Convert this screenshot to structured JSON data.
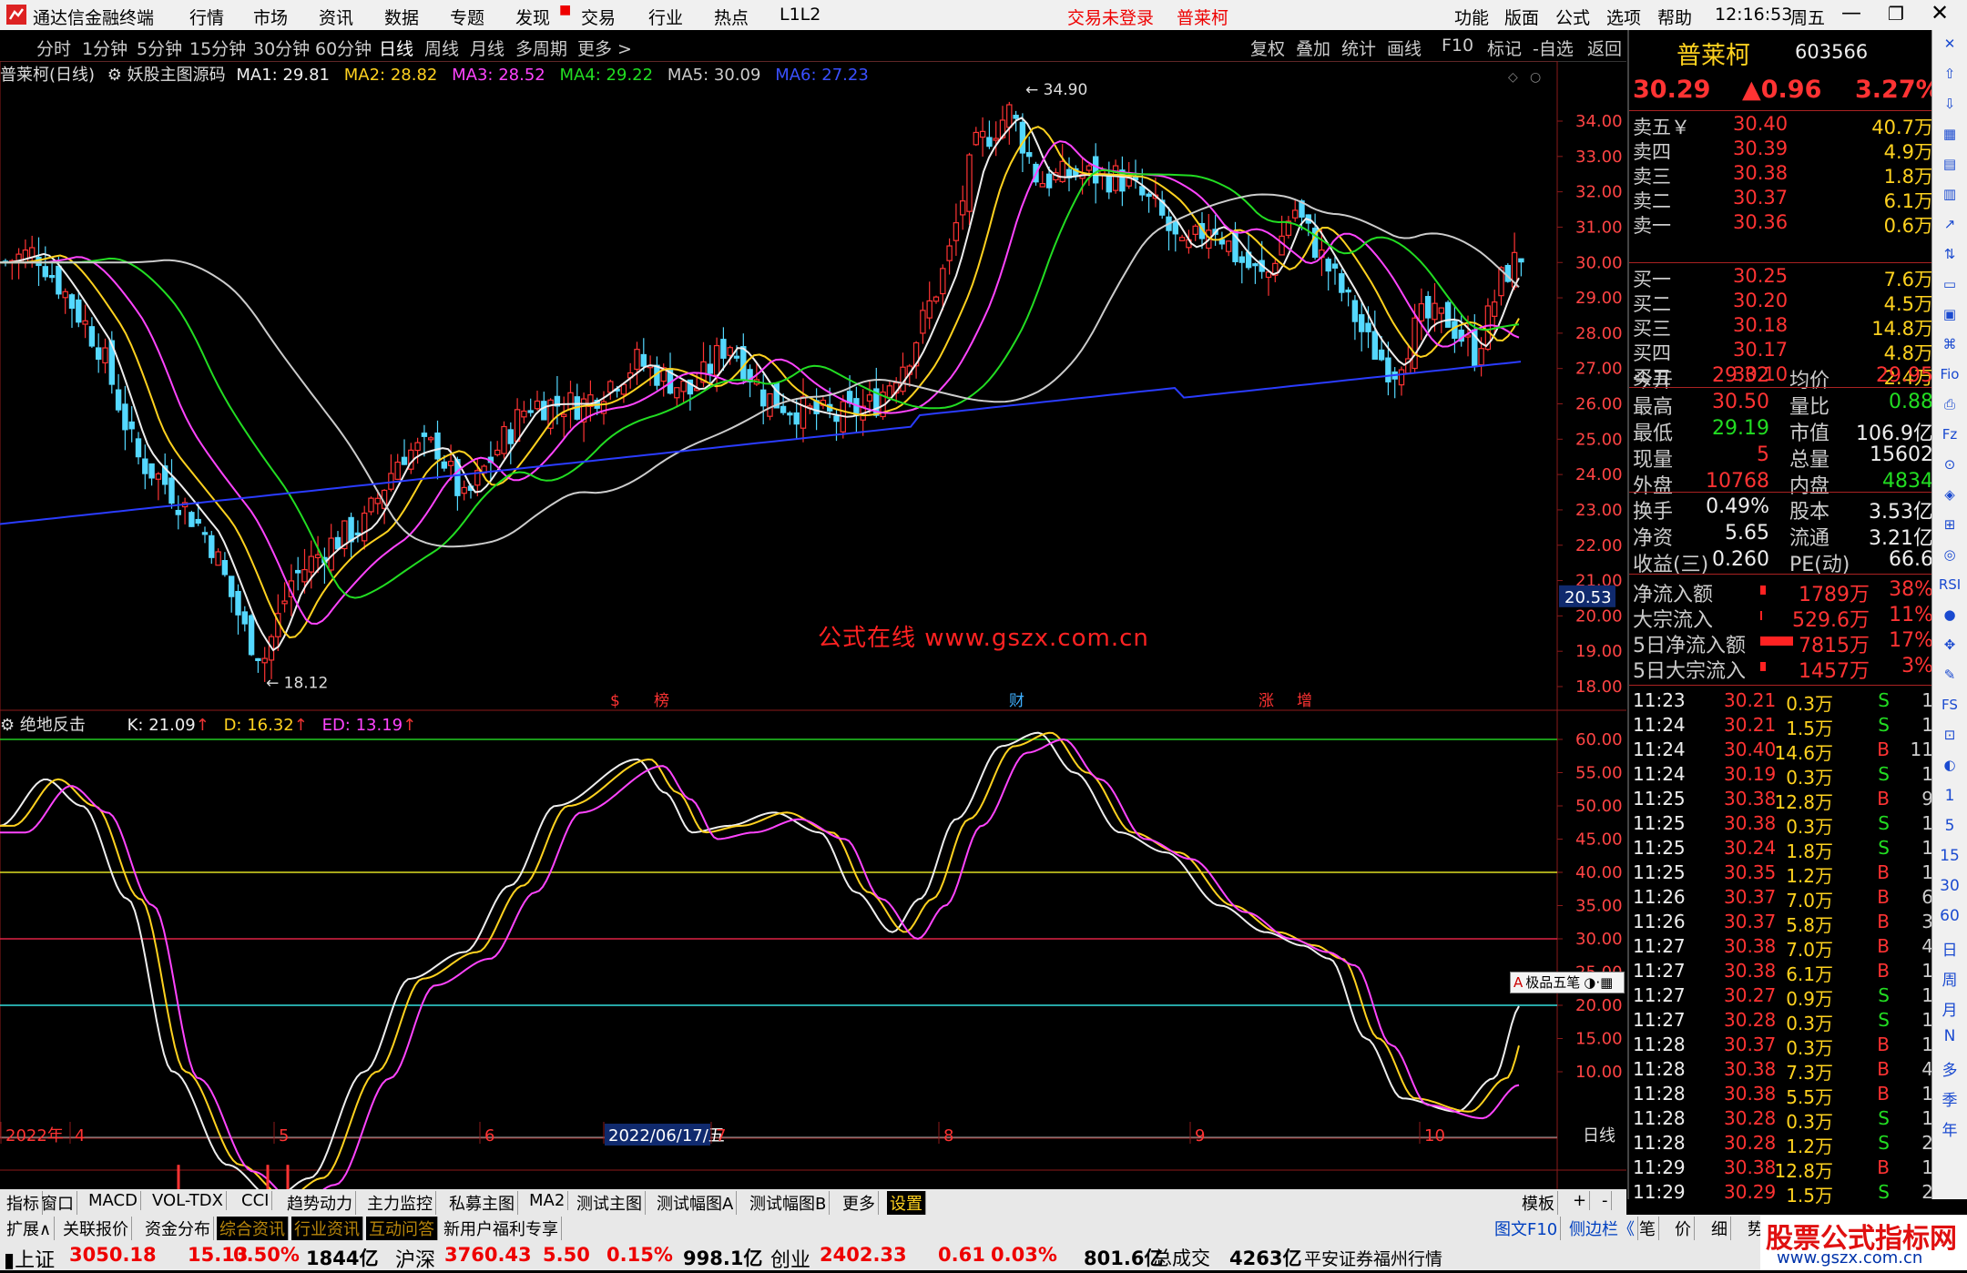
{
  "app": {
    "title": "通达信金融终端",
    "menu": [
      "行情",
      "市场",
      "资讯",
      "数据",
      "专题",
      "发现",
      "交易",
      "行业",
      "热点",
      "L1L2"
    ],
    "notice": "交易未登录",
    "stock_link": "普莱柯",
    "right_menu": [
      "功能",
      "版面",
      "公式",
      "选项",
      "帮助"
    ],
    "clock": "12:16:53",
    "weekday": "周五"
  },
  "period_bar": {
    "items": [
      "分时",
      "1分钟",
      "5分钟",
      "15分钟",
      "30分钟",
      "60分钟",
      "日线",
      "周线",
      "月线",
      "多周期",
      "更多 >"
    ],
    "active": "日线",
    "tools": [
      "复权",
      "叠加",
      "统计",
      "画线",
      "F10",
      "标记",
      "-自选",
      "返回"
    ]
  },
  "main_chart": {
    "title": "普莱柯(日线)",
    "indicator": "妖股主图源码",
    "ma": [
      {
        "label": "MA1: 29.81",
        "color": "#eeeeee"
      },
      {
        "label": "MA2: 28.82",
        "color": "#ffd21f"
      },
      {
        "label": "MA3: 28.52",
        "color": "#ff44ff"
      },
      {
        "label": "MA4: 29.22",
        "color": "#22dd22"
      },
      {
        "label": "MA5: 30.09",
        "color": "#cccccc"
      },
      {
        "label": "MA6: 27.23",
        "color": "#3a50ff"
      }
    ],
    "high_label": "34.90",
    "low_label": "18.12",
    "cursor_price": "20.53",
    "y_ticks": [
      "34.00",
      "33.00",
      "32.00",
      "31.00",
      "30.00",
      "29.00",
      "28.00",
      "27.00",
      "26.00",
      "25.00",
      "24.00",
      "23.00",
      "22.00",
      "21.00",
      "20.00",
      "19.00",
      "18.00"
    ],
    "event_tags": [
      "$",
      "榜",
      "财",
      "涨",
      "增"
    ],
    "watermark": "公式在线  www.gszx.com.cn"
  },
  "sub_chart": {
    "title": "绝地反击",
    "k": "K: 21.09",
    "d": "D: 16.32",
    "ed": "ED: 13.19",
    "y_ticks": [
      "60.00",
      "55.00",
      "50.00",
      "45.00",
      "40.00",
      "35.00",
      "30.00",
      "25.00",
      "20.00",
      "15.00",
      "10.00"
    ],
    "ime_label": "极品五笔"
  },
  "x_axis": {
    "labels": [
      "2022年",
      "4",
      "5",
      "6",
      "2022/06/17/五",
      "7",
      "8",
      "9",
      "10"
    ],
    "period": "日线"
  },
  "quote": {
    "name": "普莱柯",
    "code": "603566",
    "price": "30.29",
    "change": "▲0.96",
    "pct": "3.27%",
    "asks": [
      {
        "label": "卖五￥",
        "price": "30.40",
        "vol": "40.7万"
      },
      {
        "label": "卖四",
        "price": "30.39",
        "vol": "4.9万"
      },
      {
        "label": "卖三",
        "price": "30.38",
        "vol": "1.8万"
      },
      {
        "label": "卖二",
        "price": "30.37",
        "vol": "6.1万"
      },
      {
        "label": "卖一",
        "price": "30.36",
        "vol": "0.6万"
      }
    ],
    "bids": [
      {
        "label": "买一",
        "price": "30.25",
        "vol": "7.6万"
      },
      {
        "label": "买二",
        "price": "30.20",
        "vol": "4.5万"
      },
      {
        "label": "买三",
        "price": "30.18",
        "vol": "14.8万"
      },
      {
        "label": "买四",
        "price": "30.17",
        "vol": "4.8万"
      },
      {
        "label": "买五",
        "price": "30.10",
        "vol": "2.4万"
      }
    ],
    "stats": [
      {
        "l1": "今开",
        "v1": "29.32",
        "c1": "red",
        "l2": "均价",
        "v2": "29.95",
        "c2": "red"
      },
      {
        "l1": "最高",
        "v1": "30.50",
        "c1": "red",
        "l2": "量比",
        "v2": "0.88",
        "c2": "grn"
      },
      {
        "l1": "最低",
        "v1": "29.19",
        "c1": "grn",
        "l2": "市值",
        "v2": "106.9亿",
        "c2": "wht"
      },
      {
        "l1": "现量",
        "v1": "5",
        "c1": "red",
        "l2": "总量",
        "v2": "15602",
        "c2": "wht"
      },
      {
        "l1": "外盘",
        "v1": "10768",
        "c1": "red",
        "l2": "内盘",
        "v2": "4834",
        "c2": "grn"
      }
    ],
    "finance": [
      {
        "l1": "换手",
        "v1": "0.49%",
        "l2": "股本",
        "v2": "3.53亿"
      },
      {
        "l1": "净资",
        "v1": "5.65",
        "l2": "流通",
        "v2": "3.21亿"
      },
      {
        "l1": "收益(三)",
        "v1": "0.260",
        "l2": "PE(动)",
        "v2": "66.6"
      }
    ],
    "flows": [
      {
        "label": "净流入额",
        "value": "1789万",
        "pct": "38%"
      },
      {
        "label": "大宗流入",
        "value": "529.6万",
        "pct": "11%"
      },
      {
        "label": "5日净流入额",
        "value": "7815万",
        "pct": "17%"
      },
      {
        "label": "5日大宗流入",
        "value": "1457万",
        "pct": "3%"
      }
    ],
    "ticks": [
      {
        "t": "11:23",
        "p": "30.21",
        "v": "0.3万",
        "s": "S",
        "n": "1"
      },
      {
        "t": "11:24",
        "p": "30.21",
        "v": "1.5万",
        "s": "S",
        "n": "1"
      },
      {
        "t": "11:24",
        "p": "30.40",
        "v": "14.6万",
        "s": "B",
        "n": "11"
      },
      {
        "t": "11:24",
        "p": "30.19",
        "v": "0.3万",
        "s": "S",
        "n": "1"
      },
      {
        "t": "11:25",
        "p": "30.38",
        "v": "12.8万",
        "s": "B",
        "n": "9"
      },
      {
        "t": "11:25",
        "p": "30.38",
        "v": "0.3万",
        "s": "S",
        "n": "1"
      },
      {
        "t": "11:25",
        "p": "30.24",
        "v": "1.8万",
        "s": "S",
        "n": "1"
      },
      {
        "t": "11:25",
        "p": "30.35",
        "v": "1.2万",
        "s": "B",
        "n": "1"
      },
      {
        "t": "11:26",
        "p": "30.37",
        "v": "7.0万",
        "s": "B",
        "n": "6"
      },
      {
        "t": "11:26",
        "p": "30.37",
        "v": "5.8万",
        "s": "B",
        "n": "3"
      },
      {
        "t": "11:27",
        "p": "30.38",
        "v": "7.0万",
        "s": "B",
        "n": "4"
      },
      {
        "t": "11:27",
        "p": "30.38",
        "v": "6.1万",
        "s": "B",
        "n": "1"
      },
      {
        "t": "11:27",
        "p": "30.27",
        "v": "0.9万",
        "s": "S",
        "n": "1"
      },
      {
        "t": "11:27",
        "p": "30.28",
        "v": "0.3万",
        "s": "S",
        "n": "1"
      },
      {
        "t": "11:28",
        "p": "30.37",
        "v": "0.3万",
        "s": "B",
        "n": "1"
      },
      {
        "t": "11:28",
        "p": "30.38",
        "v": "7.3万",
        "s": "B",
        "n": "4"
      },
      {
        "t": "11:28",
        "p": "30.38",
        "v": "5.5万",
        "s": "B",
        "n": "1"
      },
      {
        "t": "11:28",
        "p": "30.28",
        "v": "0.3万",
        "s": "S",
        "n": "1"
      },
      {
        "t": "11:28",
        "p": "30.28",
        "v": "1.2万",
        "s": "S",
        "n": "2"
      },
      {
        "t": "11:29",
        "p": "30.38",
        "v": "12.8万",
        "s": "B",
        "n": "1"
      },
      {
        "t": "11:29",
        "p": "30.29",
        "v": "1.5万",
        "s": "S",
        "n": "2"
      }
    ]
  },
  "side_toolbar": [
    "✕",
    "⇧",
    "⇩",
    "",
    "",
    "",
    "",
    "",
    "",
    "",
    "",
    "Fio",
    "",
    "Fz",
    "",
    "",
    "",
    "",
    "RSI",
    "",
    "",
    "",
    "FS",
    "",
    "",
    "1",
    "5",
    "15",
    "30",
    "60",
    "日",
    "周",
    "月",
    "N",
    "多",
    "季",
    "年"
  ],
  "bottom_tabs": [
    "指标",
    "窗口",
    "MACD",
    "VOL-TDX",
    "CCI",
    "趋势动力",
    "主力监控",
    "私募主图",
    "MA2",
    "测试主图",
    "测试幅图A",
    "测试幅图B",
    "更多",
    "设置"
  ],
  "bottom_tabs_right": [
    "模板",
    "+",
    "-"
  ],
  "info_tabs": [
    "扩展∧",
    "关联报价",
    "资金分布",
    "综合资讯",
    "行业资讯",
    "互动问答",
    "新用户福利专享"
  ],
  "info_tabs_right": [
    "图文F10",
    "侧边栏《",
    "笔",
    "价",
    "细",
    "势"
  ],
  "status": [
    {
      "name": "上证",
      "val": "3050.18",
      "chg": "15.13",
      "pct": "0.50%",
      "amt": "1844亿"
    },
    {
      "name": "沪深",
      "val": "3760.43",
      "chg": "5.50",
      "pct": "0.15%",
      "amt": "998.1亿"
    },
    {
      "name": "创业",
      "val": "2402.33",
      "chg": "0.61",
      "pct": "0.03%",
      "amt": "801.6亿"
    }
  ],
  "status_extra": {
    "label": "总成交",
    "value": "4263亿",
    "broker": "平安证券福州行情"
  },
  "brand": {
    "line1": "股票公式指标网",
    "line2": "www.gszx.com.cn"
  }
}
